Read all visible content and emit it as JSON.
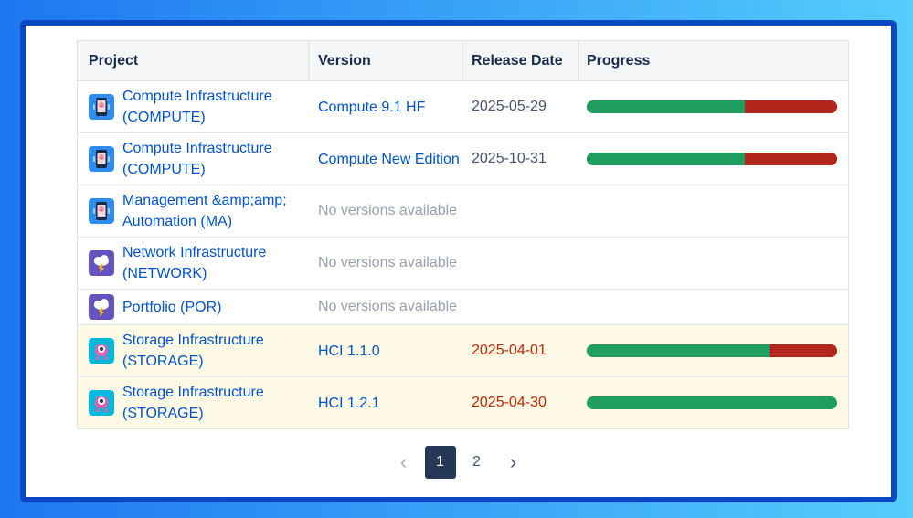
{
  "table": {
    "headers": [
      "Project",
      "Version",
      "Release Date",
      "Progress"
    ],
    "rows": [
      {
        "icon": "phone-robot-icon",
        "project": "Compute Infrastructure (COMPUTE)",
        "version": "Compute 9.1 HF",
        "date": "2025-05-29",
        "date_late": false,
        "progress_done": 0.63,
        "no_versions": false,
        "highlight": false
      },
      {
        "icon": "phone-robot-icon",
        "project": "Compute Infrastructure (COMPUTE)",
        "version": "Compute New Edition",
        "date": "2025-10-31",
        "date_late": false,
        "progress_done": 0.63,
        "no_versions": false,
        "highlight": false
      },
      {
        "icon": "phone-robot-icon",
        "project": "Management &amp;amp; Automation (MA)",
        "version": "No versions available",
        "date": "",
        "date_late": false,
        "progress_done": null,
        "no_versions": true,
        "highlight": false
      },
      {
        "icon": "storm-cloud-icon",
        "project": "Network Infrastructure (NETWORK)",
        "version": "No versions available",
        "date": "",
        "date_late": false,
        "progress_done": null,
        "no_versions": true,
        "highlight": false
      },
      {
        "icon": "storm-cloud-icon",
        "project": "Portfolio (POR)",
        "version": "No versions available",
        "date": "",
        "date_late": false,
        "progress_done": null,
        "no_versions": true,
        "highlight": false,
        "short": true
      },
      {
        "icon": "cyclops-robot-icon",
        "project": "Storage Infrastructure (STORAGE)",
        "version": "HCI 1.1.0",
        "date": "2025-04-01",
        "date_late": true,
        "progress_done": 0.73,
        "no_versions": false,
        "highlight": true
      },
      {
        "icon": "cyclops-robot-icon",
        "project": "Storage Infrastructure (STORAGE)",
        "version": "HCI 1.2.1",
        "date": "2025-04-30",
        "date_late": true,
        "progress_done": 1.0,
        "no_versions": false,
        "highlight": true
      }
    ]
  },
  "pagination": {
    "prev_icon": "chevron-left-icon",
    "next_icon": "chevron-right-icon",
    "pages": [
      "1",
      "2"
    ],
    "current": "1"
  },
  "colors": {
    "link": "#0052cc",
    "late_date": "#bf2600",
    "progress_done": "#1f9e60",
    "progress_todo": "#b3261e",
    "row_highlight": "#fffae6",
    "active_page": "#253858"
  }
}
